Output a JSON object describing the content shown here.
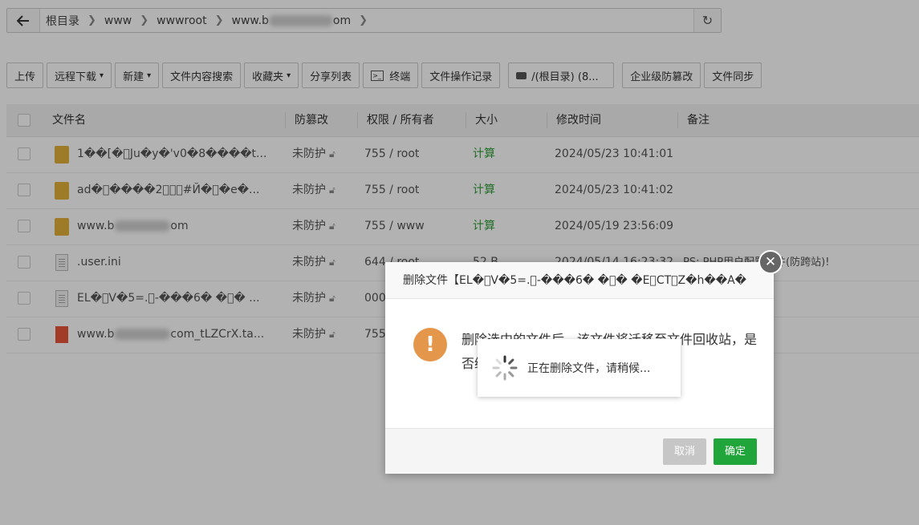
{
  "path": {
    "crumbs": [
      "根目录",
      "www",
      "wwwroot",
      "www.b",
      "om"
    ]
  },
  "toolbar": {
    "upload": "上传",
    "remote_download": "远程下载",
    "new": "新建",
    "search_content": "文件内容搜索",
    "favorites": "收藏夹",
    "share_list": "分享列表",
    "terminal": "终端",
    "file_log": "文件操作记录",
    "disk": "/(根目录) (8...",
    "tamper_proof": "企业级防篡改",
    "file_sync": "文件同步"
  },
  "table": {
    "headers": {
      "name": "文件名",
      "tamper": "防篡改",
      "perm": "权限 / 所有者",
      "size": "大小",
      "mtime": "修改时间",
      "note": "备注"
    },
    "rows": [
      {
        "name": "1��[�\u0000Ju�y�'v0�8����t...",
        "tamper": "未防护",
        "perm": "755 / root",
        "size": "计算",
        "mtime": "2024/05/23 10:41:01",
        "note": ""
      },
      {
        "name": "ad�\u0000����2\u0000\u0000\u0000#Й�\u0000�e�...",
        "tamper": "未防护",
        "perm": "755 / root",
        "size": "计算",
        "mtime": "2024/05/23 10:41:02",
        "note": ""
      },
      {
        "name": "www.b",
        "name_tail": "om",
        "tamper": "未防护",
        "perm": "755 / www",
        "size": "计算",
        "mtime": "2024/05/19 23:56:09",
        "note": ""
      },
      {
        "name": ".user.ini",
        "tamper": "未防护",
        "perm": "644 / root",
        "size": "52 B",
        "mtime": "2024/05/14 16:23:32",
        "note": "PS: PHP用户配置文件(防跨站)!"
      },
      {
        "name": "EL�\u0000V�5=.\u0000-���6� �\u0000� ...",
        "tamper": "未防护",
        "perm": "000",
        "size": "",
        "mtime": "",
        "note": ""
      },
      {
        "name": "www.b",
        "name_tail": "com_tLZCrX.ta...",
        "tamper": "未防护",
        "perm": "755",
        "size": "",
        "mtime": "",
        "note": ""
      }
    ]
  },
  "modal": {
    "title": "删除文件【EL�\u0000V�5=.\u0000-���6� �\u0000� �E\u0000CT\u0000Z�h��A�",
    "message": "删除选中的文件后，该文件将迁移至文件回收站，是否继续操作？",
    "cancel": "取消",
    "confirm": "确定"
  },
  "loading": {
    "text": "正在删除文件，请稍候..."
  }
}
